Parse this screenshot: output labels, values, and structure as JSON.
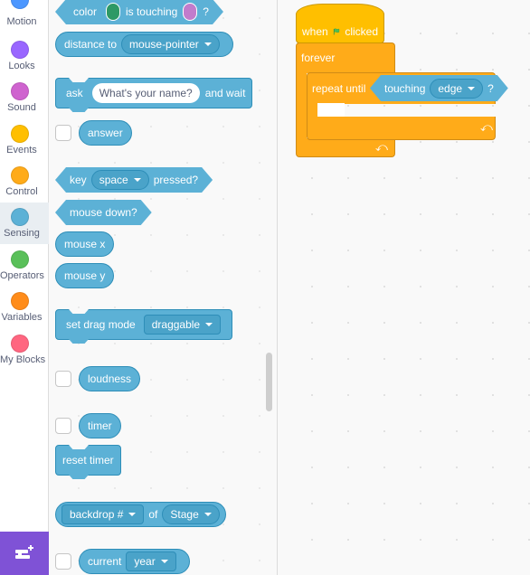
{
  "categories": [
    {
      "label": "Motion",
      "color": "#4c97ff"
    },
    {
      "label": "Looks",
      "color": "#9966ff"
    },
    {
      "label": "Sound",
      "color": "#cf63cf"
    },
    {
      "label": "Events",
      "color": "#ffbf00"
    },
    {
      "label": "Control",
      "color": "#ffab19"
    },
    {
      "label": "Sensing",
      "color": "#5cb1d6",
      "selected": true
    },
    {
      "label": "Operators",
      "color": "#59c059"
    },
    {
      "label": "Variables",
      "color": "#ff8c1a"
    },
    {
      "label": "My Blocks",
      "color": "#ff6680"
    }
  ],
  "extension_button": {
    "icon": "add-extension-icon",
    "color": "#7f52d6"
  },
  "palette": {
    "color_touching": {
      "prefix": "color",
      "middle": "is touching",
      "suffix": "?",
      "color1": "#2e9966",
      "color2": "#c17ccc"
    },
    "distance_to": {
      "label": "distance to",
      "value": "mouse-pointer"
    },
    "ask": {
      "label": "ask",
      "value": "What's your name?",
      "suffix": "and wait"
    },
    "answer": {
      "label": "answer"
    },
    "key_pressed": {
      "prefix": "key",
      "value": "space",
      "suffix": "pressed?"
    },
    "mouse_down": {
      "label": "mouse down?"
    },
    "mouse_x": {
      "label": "mouse x"
    },
    "mouse_y": {
      "label": "mouse y"
    },
    "set_drag_mode": {
      "label": "set drag mode",
      "value": "draggable"
    },
    "loudness": {
      "label": "loudness"
    },
    "timer": {
      "label": "timer"
    },
    "reset_timer": {
      "label": "reset timer"
    },
    "backdrop_of": {
      "value": "backdrop #",
      "middle": "of",
      "target": "Stage"
    },
    "current": {
      "label": "current",
      "value": "year"
    }
  },
  "script": {
    "hat": {
      "prefix": "when",
      "suffix": "clicked",
      "icon": "green-flag-icon"
    },
    "forever": {
      "label": "forever"
    },
    "repeat_until": {
      "label": "repeat until",
      "condition": {
        "label": "touching",
        "value": "edge",
        "suffix": "?"
      }
    }
  }
}
